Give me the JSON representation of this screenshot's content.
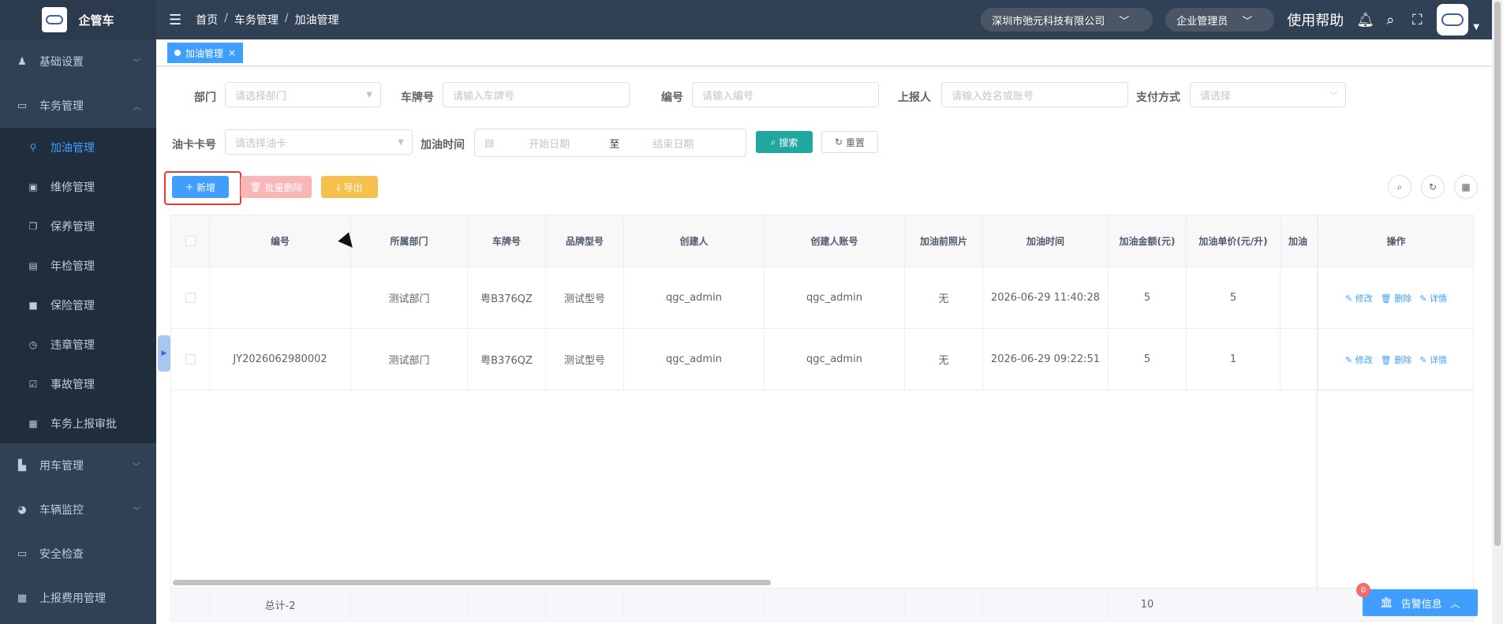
{
  "app": {
    "name": "企管车"
  },
  "breadcrumb": [
    "首页",
    "车务管理",
    "加油管理"
  ],
  "header": {
    "company": "深圳市弛元科技有限公司",
    "role": "企业管理员",
    "help": "使用帮助"
  },
  "sidebar": {
    "items": [
      {
        "label": "基础设置",
        "icon": "user-settings-icon",
        "arrow": "﹀"
      },
      {
        "label": "车务管理",
        "icon": "monitor-icon",
        "arrow": "︿"
      },
      {
        "label": "用车管理",
        "icon": "car-use-icon",
        "arrow": "﹀"
      },
      {
        "label": "车辆监控",
        "icon": "globe-icon",
        "arrow": "﹀"
      },
      {
        "label": "安全检查",
        "icon": "check-icon"
      },
      {
        "label": "上报费用管理",
        "icon": "grid-icon"
      }
    ],
    "sub_items": [
      {
        "label": "加油管理",
        "icon": "fuel-icon"
      },
      {
        "label": "维修管理",
        "icon": "toolbox-icon"
      },
      {
        "label": "保养管理",
        "icon": "copy-icon"
      },
      {
        "label": "年检管理",
        "icon": "calendar-icon"
      },
      {
        "label": "保险管理",
        "icon": "lock-icon"
      },
      {
        "label": "违章管理",
        "icon": "clock-icon"
      },
      {
        "label": "事故管理",
        "icon": "checkbox-icon"
      },
      {
        "label": "车务上报审批",
        "icon": "document-icon"
      }
    ]
  },
  "tab": {
    "label": "加油管理",
    "close": "×"
  },
  "filters": {
    "dept": {
      "label": "部门",
      "placeholder": "请选择部门"
    },
    "plate": {
      "label": "车牌号",
      "placeholder": "请输入车牌号"
    },
    "code": {
      "label": "编号",
      "placeholder": "请输入编号"
    },
    "reporter": {
      "label": "上报人",
      "placeholder": "请输入姓名或账号"
    },
    "pay": {
      "label": "支付方式",
      "placeholder": "请选择"
    },
    "card": {
      "label": "油卡卡号",
      "placeholder": "请选择油卡"
    },
    "time": {
      "label": "加油时间",
      "start": "开始日期",
      "to": "至",
      "end": "结束日期"
    }
  },
  "buttons": {
    "search": "搜索",
    "reset": "重置",
    "add": "新增",
    "batch_delete": "批量删除",
    "export": "导出"
  },
  "table": {
    "columns": [
      "编号",
      "所属部门",
      "车牌号",
      "品牌型号",
      "创建人",
      "创建人账号",
      "加油前照片",
      "加油时间",
      "加油金额(元)",
      "加油单价(元/升)",
      "加油",
      "操作"
    ],
    "rows": [
      [
        "",
        "测试部门",
        "粤B376QZ",
        "测试型号",
        "qgc_admin",
        "qgc_admin",
        "无",
        "2026-06-29 11:40:28",
        "5",
        "5",
        ""
      ],
      [
        "JY2026062980002",
        "测试部门",
        "粤B376QZ",
        "测试型号",
        "qgc_admin",
        "qgc_admin",
        "无",
        "2026-06-29 09:22:51",
        "5",
        "1",
        ""
      ]
    ],
    "ops": {
      "edit": "修改",
      "delete": "删除",
      "detail": "详情"
    },
    "footer": {
      "total": "总计-2",
      "amount_sum": "10"
    }
  },
  "alert": {
    "label": "告警信息",
    "count": "0"
  }
}
